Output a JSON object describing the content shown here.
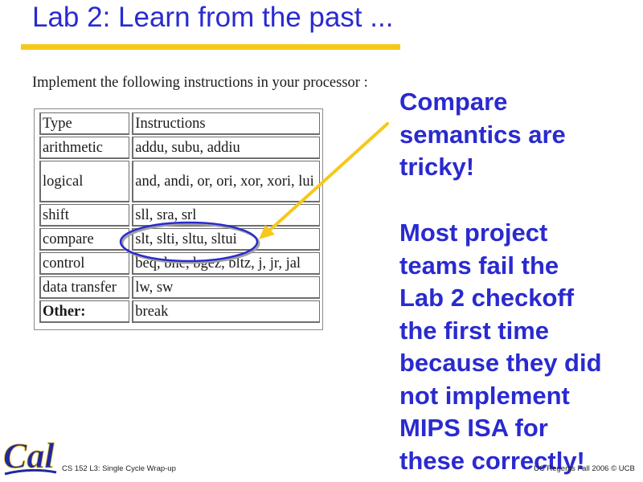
{
  "slide": {
    "title": "Lab 2: Learn from the past ...",
    "colors": {
      "title_text": "#2a2ad0",
      "rule": "#f6c81a",
      "arrow": "#f6c81a",
      "ellipse": "#2a2ad0"
    },
    "caption": "Implement the following instructions in your processor :",
    "table": {
      "headers": [
        "Type",
        "Instructions"
      ],
      "rows": [
        {
          "type": "arithmetic",
          "instructions": "addu, subu, addiu"
        },
        {
          "type": "logical",
          "instructions": "and, andi, or, ori, xor, xori, lui"
        },
        {
          "type": "shift",
          "instructions": "sll, sra, srl"
        },
        {
          "type": "compare",
          "instructions": "slt, slti, sltu, sltui"
        },
        {
          "type": "control",
          "instructions": "beq, bne, bgez, bltz, j, jr, jal"
        },
        {
          "type": "data transfer",
          "instructions": "lw, sw"
        },
        {
          "type": "Other:",
          "instructions": "break"
        }
      ],
      "highlighted_row": "compare"
    },
    "callouts": [
      {
        "lines": [
          "Compare",
          "semantics are",
          "tricky!"
        ]
      },
      {
        "lines": [
          "Most project",
          "teams fail the",
          "Lab 2 checkoff",
          "the first time",
          "because they did",
          "not implement",
          "MIPS ISA for",
          "these correctly!"
        ]
      }
    ],
    "footer": {
      "logo_text": "Cal",
      "left": "CS 152 L3:  Single Cycle Wrap-up",
      "right": "UC Regents Fall 2006 © UCB"
    }
  }
}
